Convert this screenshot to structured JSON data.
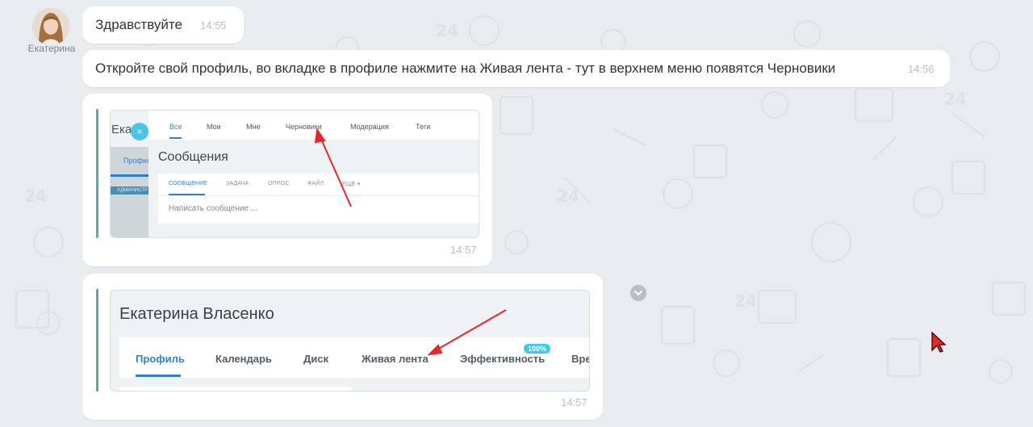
{
  "chat": {
    "author": "Екатерина",
    "messages": [
      {
        "text": "Здравствуйте",
        "time": "14:55"
      },
      {
        "text": "Откройте свой профиль, во вкладке в профиле нажмите на Живая лента - тут в верхнем меню появятся Черновики",
        "time": "14:56"
      },
      {
        "time": "14:57"
      },
      {
        "time": "14:57"
      }
    ]
  },
  "screenshot1": {
    "left_title": "Ека",
    "left_tab": "Профиль",
    "left_strip": "АДМИНИСТР",
    "close_symbol": "×",
    "tabs": [
      "Все",
      "Мои",
      "Мне",
      "Черновики",
      "Модерация",
      "Теги"
    ],
    "title": "Сообщения",
    "composer_tabs": [
      "СООБЩЕНИЕ",
      "ЗАДАЧА",
      "ОПРОС",
      "ФАЙЛ",
      "ЕЩЁ ▾"
    ],
    "placeholder": "Написать сообщение ..."
  },
  "screenshot2": {
    "user_name": "Екатерина Власенко",
    "tabs": [
      "Профиль",
      "Календарь",
      "Диск",
      "Живая лента",
      "Эффективность",
      "Вре"
    ],
    "badge": "100%"
  },
  "colors": {
    "background": "#e9ecee",
    "bubble": "#ffffff",
    "accent_blue": "#2f7fd0",
    "quote_bar": "#5ba5b4",
    "annotation_arrow": "#e8262a"
  }
}
